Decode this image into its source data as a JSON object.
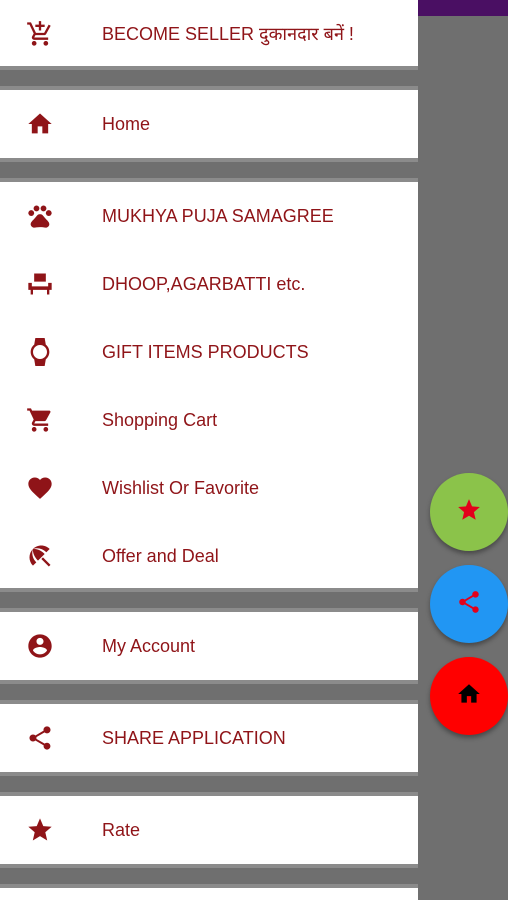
{
  "drawer": {
    "items": [
      {
        "label": "BECOME SELLER दुकानदार बनें !",
        "icon": "add-to-cart-icon"
      },
      {
        "label": "Home",
        "icon": "home-icon"
      },
      {
        "label": "MUKHYA PUJA SAMAGREE",
        "icon": "paw-icon"
      },
      {
        "label": "DHOOP,AGARBATTI etc.",
        "icon": "seat-icon"
      },
      {
        "label": "GIFT ITEMS PRODUCTS",
        "icon": "watch-icon"
      },
      {
        "label": "Shopping Cart",
        "icon": "cart-icon"
      },
      {
        "label": "Wishlist Or Favorite",
        "icon": "heart-icon"
      },
      {
        "label": "Offer and Deal",
        "icon": "beach-umbrella-icon"
      },
      {
        "label": "My Account",
        "icon": "account-circle-icon"
      },
      {
        "label": "SHARE APPLICATION",
        "icon": "share-icon"
      },
      {
        "label": "Rate",
        "icon": "star-icon"
      }
    ]
  },
  "fabs": [
    {
      "icon": "star-icon",
      "color": "#8bc34a"
    },
    {
      "icon": "share-icon",
      "color": "#2196f3"
    },
    {
      "icon": "home-icon",
      "color": "#ff0000"
    }
  ],
  "colors": {
    "accent": "#8f1418",
    "topbar": "#4a0f63",
    "scrim": "#6f6f6f"
  }
}
